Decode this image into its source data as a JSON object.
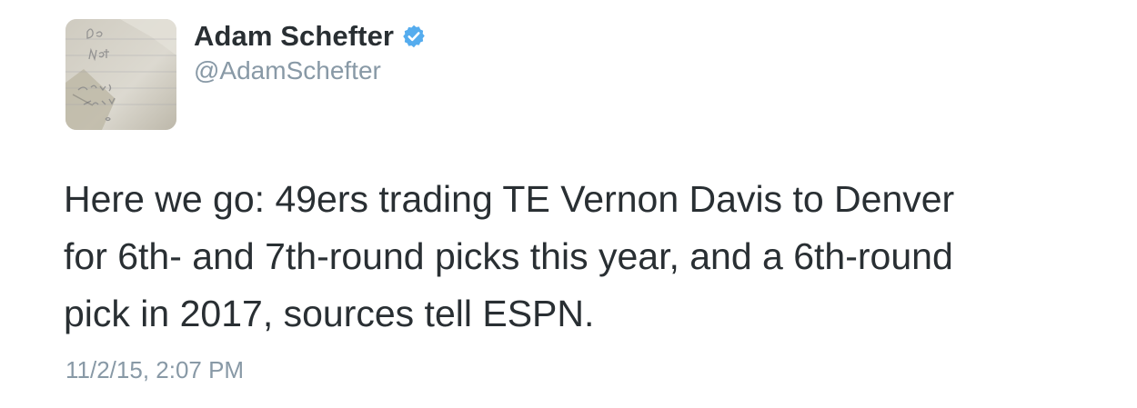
{
  "author": {
    "display_name": "Adam Schefter",
    "handle": "@AdamSchefter",
    "verified": true,
    "avatar_icon": "handwritten-note-avatar",
    "avatar_text": "Do Not Disturb Thank You"
  },
  "tweet": {
    "text": "Here we go: 49ers trading TE Vernon Davis to Denver\nfor 6th- and 7th-round picks this year, and a 6th-round\npick in 2017, sources tell ESPN.",
    "timestamp": "11/2/15, 2:07 PM"
  },
  "colors": {
    "text": "#292f33",
    "muted": "#8899a6",
    "verified_badge": "#55acee"
  }
}
